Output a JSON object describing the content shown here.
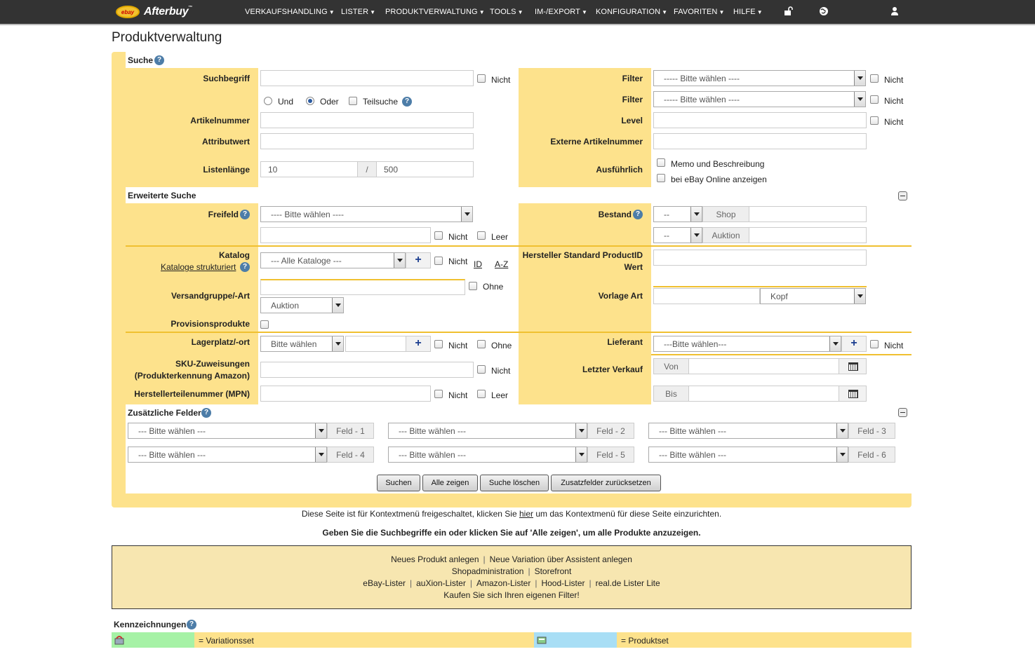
{
  "nav": {
    "brand": "Afterbuy",
    "brand_mark": "™",
    "logo_badge": "ebay",
    "items": [
      "VERKAUFSHANDLING",
      "LISTER",
      "PRODUKTVERWALTUNG",
      "TOOLS",
      "IM-/EXPORT",
      "KONFIGURATION",
      "FAVORITEN",
      "HILFE"
    ]
  },
  "page_title": "Produktverwaltung",
  "help_glyph": "?",
  "plus_glyph": "+",
  "suche": {
    "title": "Suche",
    "suchbegriff_label": "Suchbegriff",
    "nicht": "Nicht",
    "und": "Und",
    "oder": "Oder",
    "teilsuche": "Teilsuche",
    "artikelnummer_label": "Artikelnummer",
    "attributwert_label": "Attributwert",
    "listenlaenge_label": "Listenlänge",
    "listenlaenge_value": "10",
    "listenlaenge_sep": "/",
    "listenlaenge_max": "500",
    "filter_label": "Filter",
    "filter_placeholder": "----- Bitte wählen ----",
    "level_label": "Level",
    "externe_label": "Externe Artikelnummer",
    "ausfuehrlich_label": "Ausführlich",
    "memo": "Memo und Beschreibung",
    "ebay_online": "bei eBay Online anzeigen"
  },
  "erweitert": {
    "title": "Erweiterte Suche",
    "freifeld_label": "Freifeld",
    "freifeld_select": "---- Bitte wählen ----",
    "nicht": "Nicht",
    "leer": "Leer",
    "ohne": "Ohne",
    "bestand_label": "Bestand",
    "dash": "--",
    "shop": "Shop",
    "auktion": "Auktion",
    "katalog_label": "Katalog",
    "kataloge_link": "Kataloge strukturiert",
    "alle_kataloge": "--- Alle Kataloge ---",
    "id_link": "ID",
    "az_link": "A-Z",
    "hersteller_label1": "Hersteller Standard ProductID",
    "hersteller_label2": "Wert",
    "versand_label": "Versandgruppe/-Art",
    "versand_select": "Auktion",
    "vorlage_label": "Vorlage Art",
    "vorlage_select": "Kopf",
    "provision_label": "Provisionsprodukte",
    "lager_label": "Lagerplatz/-ort",
    "lager_select": "Bitte wählen",
    "lieferant_label": "Lieferant",
    "lieferant_select": "---Bitte wählen---",
    "sku_label1": "SKU-Zuweisungen",
    "sku_label2": "(Produkterkennung Amazon)",
    "mpn_label": "Herstellerteilenummer (MPN)",
    "letzter_label": "Letzter Verkauf",
    "von": "Von",
    "bis": "Bis"
  },
  "zusatz": {
    "title": "Zusätzliche Felder",
    "select_placeholder": "--- Bitte wählen ---",
    "fields": [
      "Feld - 1",
      "Feld - 2",
      "Feld - 3",
      "Feld - 4",
      "Feld - 5",
      "Feld - 6"
    ]
  },
  "buttons": {
    "suchen": "Suchen",
    "alle": "Alle zeigen",
    "loeschen": "Suche löschen",
    "reset": "Zusatzfelder zurücksetzen"
  },
  "info": {
    "context_pre": "Diese Seite ist für Kontextmenü freigeschaltet, klicken Sie",
    "context_link": "hier",
    "context_post": "um das Kontextmenü für diese Seite einzurichten.",
    "hint": "Geben Sie die Suchbegriffe ein oder klicken Sie auf 'Alle zeigen', um alle Produkte anzuzeigen."
  },
  "footer_links": {
    "separator": "|",
    "row1": [
      "Neues Produkt anlegen",
      "Neue Variation über Assistent anlegen"
    ],
    "row2": [
      "Shopadministration",
      "Storefront"
    ],
    "row3": [
      "eBay-Lister",
      "auXion-Lister",
      "Amazon-Lister",
      "Hood-Lister",
      "real.de Lister Lite"
    ],
    "row4": [
      "Kaufen Sie sich Ihren eigenen Filter!"
    ]
  },
  "legend": {
    "title": "Kennzeichnungen",
    "variationsset": "= Variationsset",
    "produktset": "= Produktset",
    "green": "#a6f2a6",
    "blue": "#a8def5"
  },
  "colors": {
    "panel": "#fde28c",
    "nav": "#333333",
    "accent": "#f0c030"
  }
}
